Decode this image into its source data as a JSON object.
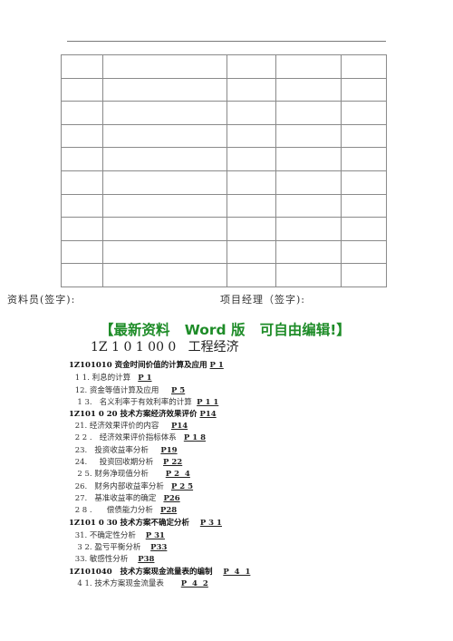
{
  "document": {
    "signatures": {
      "left_label": "资料员(签字):",
      "right_label": "项目经理（签字):"
    },
    "table": {
      "rows": 10,
      "columns": 5,
      "cells": [
        [
          "",
          "",
          "",
          "",
          ""
        ],
        [
          "",
          "",
          "",
          "",
          ""
        ],
        [
          "",
          "",
          "",
          "",
          ""
        ],
        [
          "",
          "",
          "",
          "",
          ""
        ],
        [
          "",
          "",
          "",
          "",
          ""
        ],
        [
          "",
          "",
          "",
          "",
          ""
        ],
        [
          "",
          "",
          "",
          "",
          ""
        ],
        [
          "",
          "",
          "",
          "",
          ""
        ],
        [
          "",
          "",
          "",
          "",
          ""
        ],
        [
          "",
          "",
          "",
          "",
          ""
        ]
      ]
    },
    "banner": "【最新资料   Word 版   可自由编辑!】",
    "banner_color": "#1e8c28",
    "main_title": "1Z 1 0 1 00 0   工程经济",
    "toc": [
      {
        "type": "sec",
        "text": "1Z101010 资金时间价值的计算及应用 ",
        "page": "P 1"
      },
      {
        "type": "sub",
        "text": " 1 1. 利息的计算   ",
        "page": "P 1"
      },
      {
        "type": "sub",
        "text": " 12. 资金等值计算及应用     ",
        "page": "P 5"
      },
      {
        "type": "sub",
        "text": "  1 3.   名义利率于有效利率的计算  ",
        "page": "P 1 1"
      },
      {
        "type": "sec",
        "text": "1Z101 0 20 技术方案经济效果评价 ",
        "page": "P14"
      },
      {
        "type": "sub",
        "text": " 21. 经济效果评价的内容     ",
        "page": "P14"
      },
      {
        "type": "sub",
        "text": " 2 2 .   经济效果评价指标体系   ",
        "page": "P 1 8"
      },
      {
        "type": "sub",
        "text": " 23.   投资收益率分析     ",
        "page": "P19"
      },
      {
        "type": "sub",
        "text": " 24.     投资回收期分析    ",
        "page": "P 22"
      },
      {
        "type": "sub",
        "text": "  2 5. 财务净现值分析       ",
        "page": "P 2  4"
      },
      {
        "type": "sub",
        "text": " 26.   财务内部收益率分析   ",
        "page": "P 2 5"
      },
      {
        "type": "sub",
        "text": " 27.   基准收益率的确定   ",
        "page": "P26"
      },
      {
        "type": "sub",
        "text": " 2 8 .      偿债能力分析   ",
        "page": "P28"
      },
      {
        "type": "sec",
        "text": "1Z101 0 30 技术方案不确定分析    ",
        "page": "P 3 1"
      },
      {
        "type": "sub",
        "text": " 31. 不确定性分析    ",
        "page": "P 31"
      },
      {
        "type": "sub",
        "text": "  3 2. 盈亏平衡分析    ",
        "page": "P33"
      },
      {
        "type": "sub",
        "text": " 33. 敏感性分析    ",
        "page": "P38"
      },
      {
        "type": "sec",
        "text": "1Z101040   技术方案现金流量表的编制    ",
        "page": "P  4  1"
      },
      {
        "type": "sub",
        "text": "  4 1. 技术方案现金流量表       ",
        "page": "P  4  2"
      }
    ]
  }
}
